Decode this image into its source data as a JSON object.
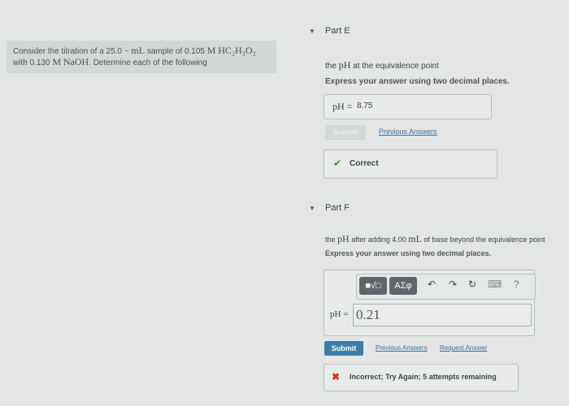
{
  "problem": {
    "text_a": "Consider the titration of a 25.0 − ",
    "unit_ml": "mL",
    "text_b": " sample of 0.105 ",
    "m1": "M",
    "acid": "HC₂H₃O₂",
    "text_c": "with 0.130 ",
    "m2": "M",
    "base": "NaOH",
    "text_d": ". Determine each of the following"
  },
  "part_e": {
    "label": "Part E",
    "q_a": "the ",
    "q_ph": "pH",
    "q_b": " at the equivalence point",
    "instruction": "Express your answer using two decimal places.",
    "answer_label": "pH =",
    "answer_value": "8.75",
    "submit_label": "Submit",
    "prev_answers": "Previous Answers",
    "feedback": "Correct"
  },
  "part_f": {
    "label": "Part F",
    "q_a": "the ",
    "q_ph": "pH",
    "q_b": " after adding 4.00 ",
    "q_ml": "mL",
    "q_c": " of base beyond the equivalence point",
    "instruction": "Express your answer using two decimal places.",
    "toolbar": {
      "template": "■√□",
      "greek": "ΑΣφ",
      "undo": "↶",
      "redo": "↷",
      "reset": "↻",
      "keyboard": "⌨",
      "help": "?"
    },
    "answer_label": "pH =",
    "answer_value": "0.21",
    "submit_label": "Submit",
    "prev_answers": "Previous Answers",
    "request_answer": "Request Answer",
    "feedback": "Incorrect; Try Again; 5 attempts remaining"
  },
  "colors": {
    "accent": "#3c7ea8",
    "correct": "#4a8a3a",
    "incorrect": "#d03030"
  }
}
